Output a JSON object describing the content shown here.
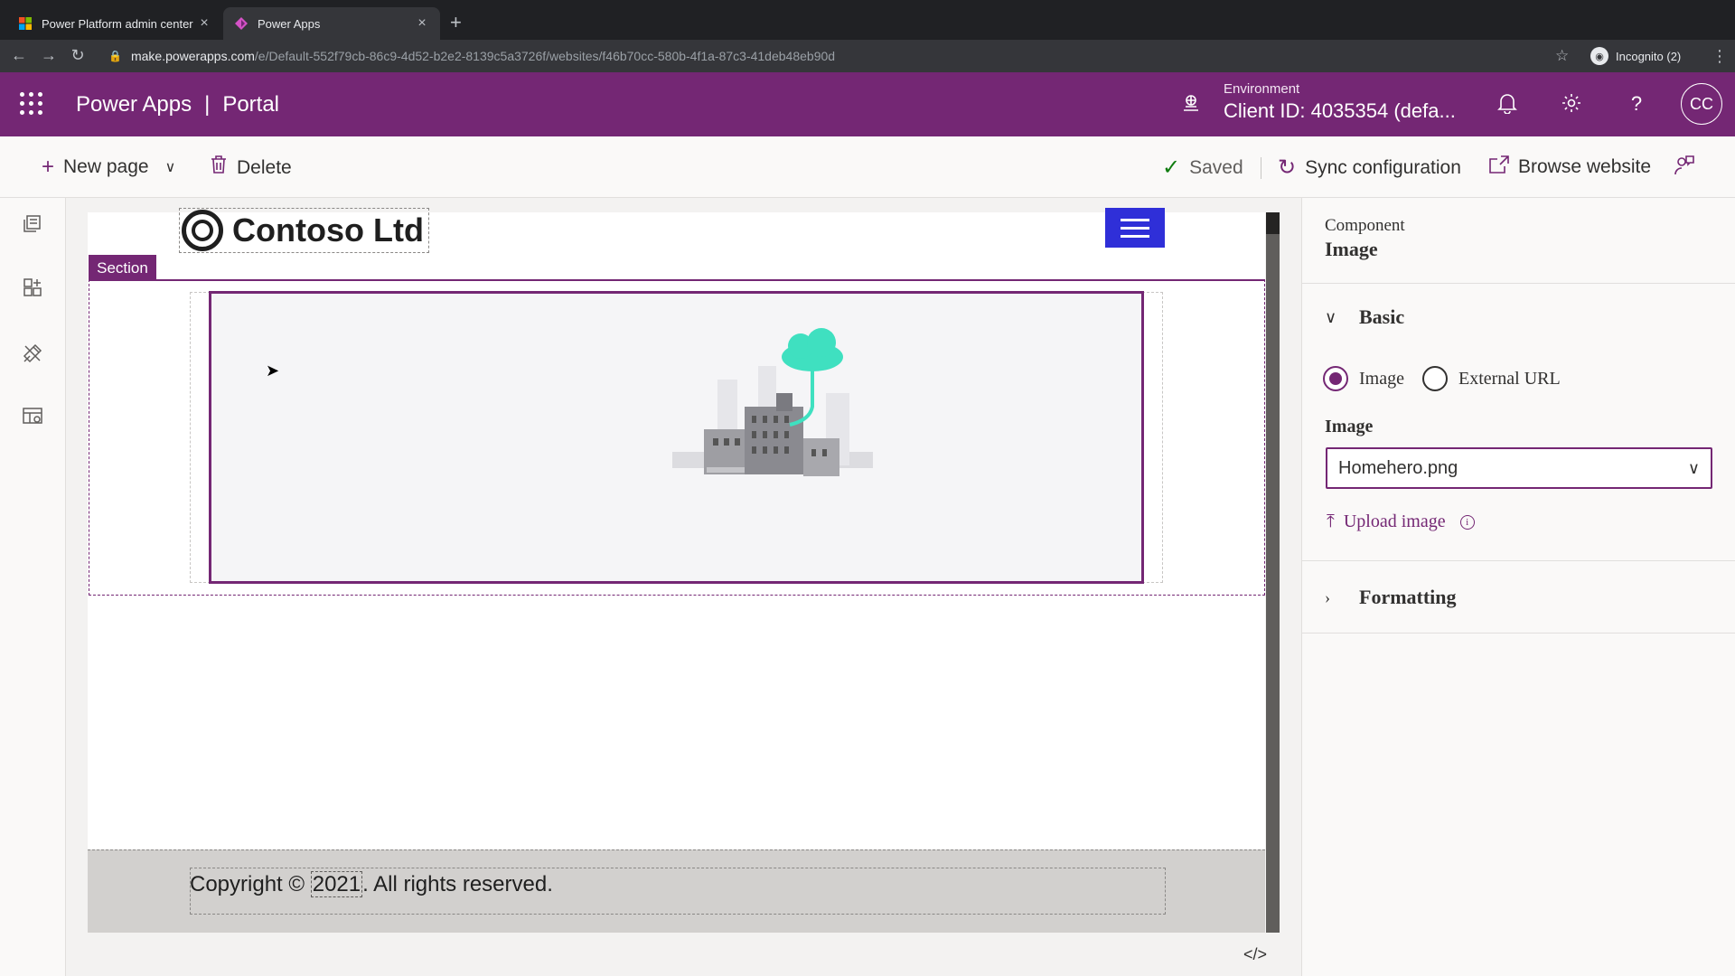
{
  "browser": {
    "tabs": [
      {
        "title": "Power Platform admin center",
        "icon": "microsoft-logo-icon",
        "active": false
      },
      {
        "title": "Power Apps",
        "icon": "power-apps-icon",
        "active": true
      }
    ],
    "url_host": "make.powerapps.com",
    "url_path": "/e/Default-552f79cb-86c9-4d52-b2e2-8139c5a3726f/websites/f46b70cc-580b-4f1a-87c3-41deb48eb90d",
    "incognito_label": "Incognito (2)"
  },
  "header": {
    "app_name": "Power Apps",
    "separator": "|",
    "section_name": "Portal",
    "env_label": "Environment",
    "env_value": "Client ID: 4035354 (defa...",
    "avatar_initials": "CC"
  },
  "commandbar": {
    "new_page": "New page",
    "delete": "Delete",
    "saved": "Saved",
    "sync": "Sync configuration",
    "browse": "Browse website"
  },
  "canvas": {
    "logo_text": "Contoso Ltd",
    "section_label": "Section",
    "copyright_prefix": "Copyright © ",
    "copyright_year": "2021",
    "copyright_suffix": ". All rights reserved.",
    "code_toggle": "</>"
  },
  "panel": {
    "label": "Component",
    "title": "Image",
    "basic_section": "Basic",
    "radio_image": "Image",
    "radio_external": "External URL",
    "image_field_label": "Image",
    "image_selected": "Homehero.png",
    "upload_label": "Upload image",
    "formatting_section": "Formatting"
  },
  "colors": {
    "brand": "#742774",
    "hamburger": "#2f2fd8",
    "illustration_accent": "#3fe0c0"
  }
}
